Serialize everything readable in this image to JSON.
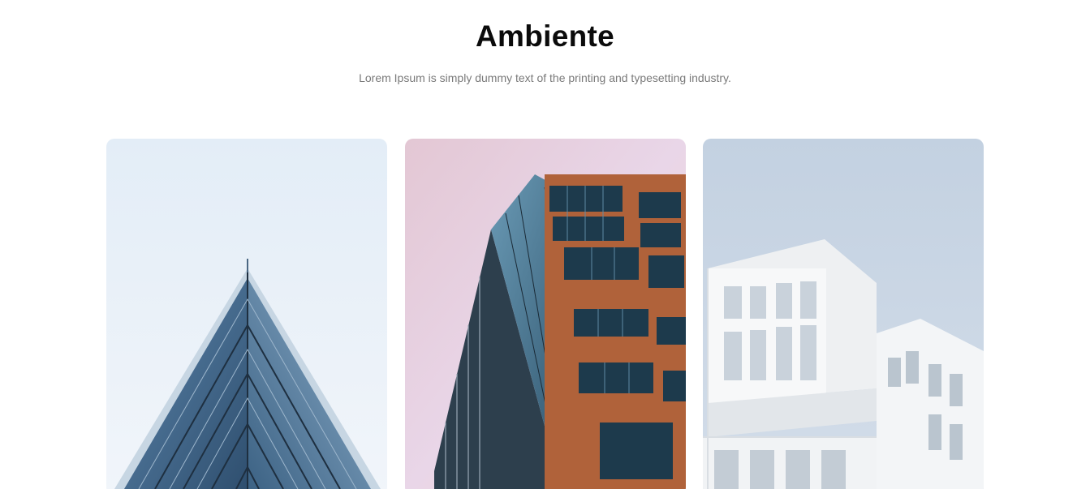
{
  "section": {
    "title": "Ambiente",
    "subtitle": "Lorem Ipsum is simply dummy text of the printing and typesetting industry."
  },
  "gallery": {
    "items": [
      {
        "subject": "glass-pyramid-building",
        "sky": "#e6eff8"
      },
      {
        "subject": "copper-glass-tower",
        "sky": "#e8d2dc"
      },
      {
        "subject": "white-modular-building",
        "sky": "#c9d6e4"
      }
    ]
  },
  "colors": {
    "title": "#0b0b0b",
    "subtitle": "#7a7a7a",
    "background": "#ffffff",
    "copper": "#b0623a",
    "glass": "#3f6f93"
  }
}
